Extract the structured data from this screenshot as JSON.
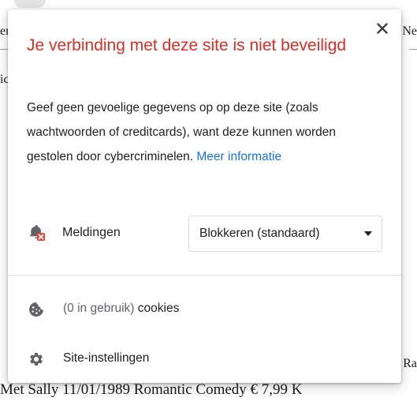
{
  "background": {
    "edge_left_1": "er",
    "edge_left_2": "ic",
    "edge_right_1": "Ne",
    "edge_right_2": "Ra",
    "bottom_row": "Met Sally 11/01/1989    Romantic Comedy € 7,99 K"
  },
  "popup": {
    "title": "Je verbinding met deze site is niet beveiligd",
    "description": "Geef geen gevoelige gegevens op op deze site (zoals wachtwoorden of creditcards), want deze kunnen worden gestolen door cybercriminelen. ",
    "more_link": "Meer informatie",
    "close_icon": "close-icon"
  },
  "permissions": [
    {
      "icon": "notification-bell-blocked-icon",
      "label": "Meldingen",
      "value": "Blokkeren (standaard)"
    }
  ],
  "cookies": {
    "icon": "cookie-icon",
    "count_text": "(0 in gebruik)",
    "label": " cookies"
  },
  "site_settings": {
    "icon": "gear-icon",
    "label": "Site-instellingen"
  },
  "colors": {
    "title_red": "#d93025",
    "link_blue": "#1a73e8",
    "text": "#202124",
    "icon_grey": "#5f6368",
    "badge_red": "#ea4335"
  }
}
